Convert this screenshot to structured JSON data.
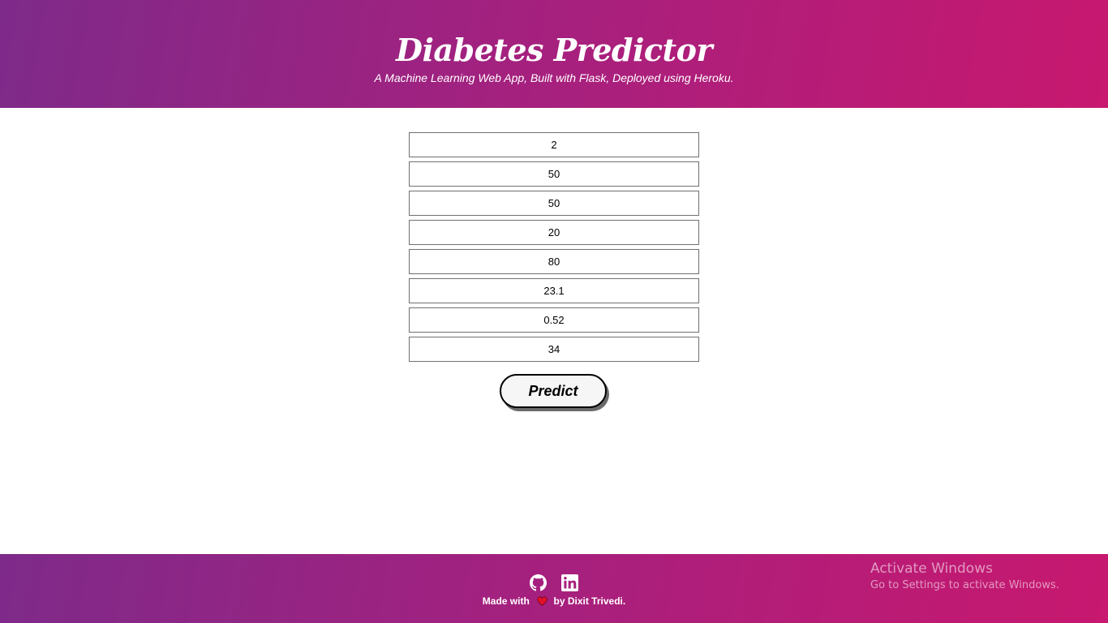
{
  "header": {
    "title": "Diabetes Predictor",
    "subtitle": "A Machine Learning Web App, Built with Flask, Deployed using Heroku."
  },
  "form": {
    "fields": [
      "2",
      "50",
      "50",
      "20",
      "80",
      "23.1",
      "0.52",
      "34"
    ],
    "submit_label": "Predict"
  },
  "footer": {
    "icons": [
      "github-icon",
      "linkedin-icon",
      "heart-icon"
    ],
    "made_with_prefix": "Made with",
    "made_with_suffix": "by Dixit Trivedi."
  },
  "watermark": {
    "title": "Activate Windows",
    "subtitle": "Go to Settings to activate Windows."
  },
  "colors": {
    "gradient_start": "#7e2a8a",
    "gradient_end": "#c8186f",
    "heart": "#e0102a"
  }
}
